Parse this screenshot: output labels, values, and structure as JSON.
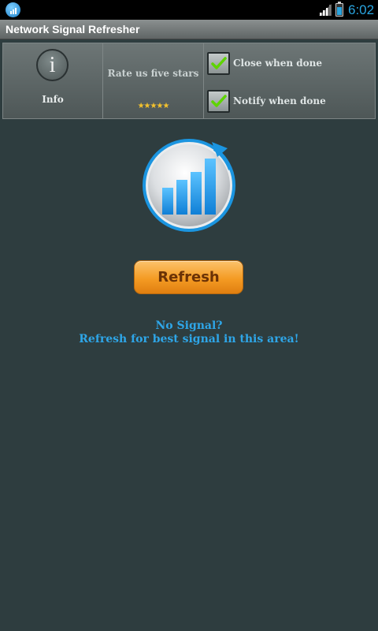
{
  "status_bar": {
    "time": "6:02",
    "icons": [
      "app-notification-icon",
      "signal-icon",
      "battery-icon"
    ],
    "accent_color": "#2aa5e0"
  },
  "title_bar": {
    "title": "Network Signal Refresher"
  },
  "top_panel": {
    "info": {
      "icon": "info-icon",
      "label": "Info"
    },
    "rate": {
      "label": "Rate us five stars",
      "stars": "★★★★★",
      "rating": 5
    },
    "options": [
      {
        "label": "Close when done",
        "checked": true
      },
      {
        "label": "Notify when done",
        "checked": true
      }
    ]
  },
  "main": {
    "logo_icon": "signal-refresh-icon",
    "refresh_button": "Refresh",
    "message_line1": "No Signal?",
    "message_line2": "Refresh for best signal in this area!"
  },
  "colors": {
    "background": "#2e3d3f",
    "button": "#f49b23",
    "message": "#2ea6e8"
  }
}
